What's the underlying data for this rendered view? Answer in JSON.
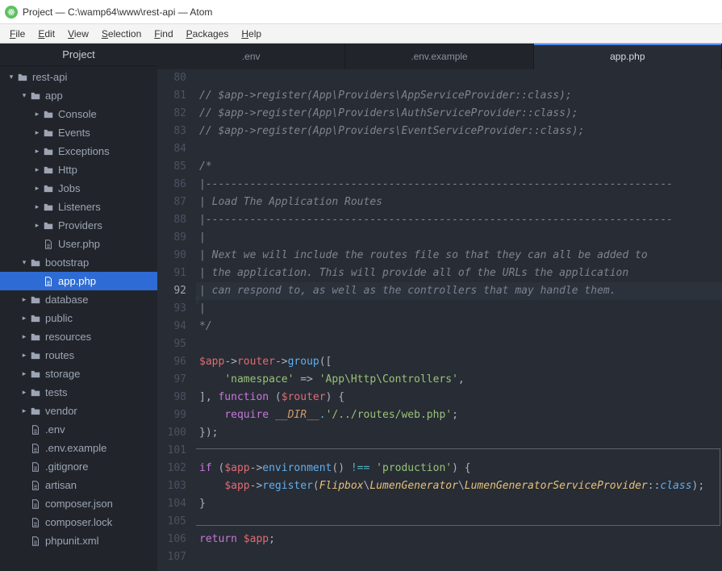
{
  "window": {
    "title": "Project — C:\\wamp64\\www\\rest-api — Atom"
  },
  "menu": {
    "items": [
      "File",
      "Edit",
      "View",
      "Selection",
      "Find",
      "Packages",
      "Help"
    ]
  },
  "sidebar": {
    "title": "Project",
    "tree": [
      {
        "depth": 0,
        "icon": "folder",
        "twist": "down",
        "label": "rest-api"
      },
      {
        "depth": 1,
        "icon": "folder",
        "twist": "down",
        "label": "app"
      },
      {
        "depth": 2,
        "icon": "folder",
        "twist": "right",
        "label": "Console"
      },
      {
        "depth": 2,
        "icon": "folder",
        "twist": "right",
        "label": "Events"
      },
      {
        "depth": 2,
        "icon": "folder",
        "twist": "right",
        "label": "Exceptions"
      },
      {
        "depth": 2,
        "icon": "folder",
        "twist": "right",
        "label": "Http"
      },
      {
        "depth": 2,
        "icon": "folder",
        "twist": "right",
        "label": "Jobs"
      },
      {
        "depth": 2,
        "icon": "folder",
        "twist": "right",
        "label": "Listeners"
      },
      {
        "depth": 2,
        "icon": "folder",
        "twist": "right",
        "label": "Providers"
      },
      {
        "depth": 2,
        "icon": "file",
        "twist": "",
        "label": "User.php"
      },
      {
        "depth": 1,
        "icon": "folder",
        "twist": "down",
        "label": "bootstrap"
      },
      {
        "depth": 2,
        "icon": "file",
        "twist": "",
        "label": "app.php",
        "selected": true
      },
      {
        "depth": 1,
        "icon": "folder",
        "twist": "right",
        "label": "database"
      },
      {
        "depth": 1,
        "icon": "folder",
        "twist": "right",
        "label": "public"
      },
      {
        "depth": 1,
        "icon": "folder",
        "twist": "right",
        "label": "resources"
      },
      {
        "depth": 1,
        "icon": "folder",
        "twist": "right",
        "label": "routes"
      },
      {
        "depth": 1,
        "icon": "folder",
        "twist": "right",
        "label": "storage"
      },
      {
        "depth": 1,
        "icon": "folder",
        "twist": "right",
        "label": "tests"
      },
      {
        "depth": 1,
        "icon": "folder",
        "twist": "right",
        "label": "vendor"
      },
      {
        "depth": 1,
        "icon": "file",
        "twist": "",
        "label": ".env"
      },
      {
        "depth": 1,
        "icon": "file",
        "twist": "",
        "label": ".env.example"
      },
      {
        "depth": 1,
        "icon": "file",
        "twist": "",
        "label": ".gitignore"
      },
      {
        "depth": 1,
        "icon": "file",
        "twist": "",
        "label": "artisan"
      },
      {
        "depth": 1,
        "icon": "file",
        "twist": "",
        "label": "composer.json"
      },
      {
        "depth": 1,
        "icon": "file",
        "twist": "",
        "label": "composer.lock"
      },
      {
        "depth": 1,
        "icon": "file",
        "twist": "",
        "label": "phpunit.xml"
      }
    ]
  },
  "tabs": [
    {
      "label": ".env",
      "active": false
    },
    {
      "label": ".env.example",
      "active": false
    },
    {
      "label": "app.php",
      "active": true
    }
  ],
  "editor": {
    "first_line": 80,
    "current_line": 92,
    "lines": [
      {
        "n": 80,
        "tokens": [
          {
            "t": "",
            "c": ""
          }
        ]
      },
      {
        "n": 81,
        "tokens": [
          {
            "t": "// $app->register(App\\Providers\\AppServiceProvider::class);",
            "c": "c-comment"
          }
        ]
      },
      {
        "n": 82,
        "tokens": [
          {
            "t": "// $app->register(App\\Providers\\AuthServiceProvider::class);",
            "c": "c-comment"
          }
        ]
      },
      {
        "n": 83,
        "tokens": [
          {
            "t": "// $app->register(App\\Providers\\EventServiceProvider::class);",
            "c": "c-comment"
          }
        ]
      },
      {
        "n": 84,
        "tokens": [
          {
            "t": "",
            "c": ""
          }
        ]
      },
      {
        "n": 85,
        "tokens": [
          {
            "t": "/*",
            "c": "c-comment"
          }
        ]
      },
      {
        "n": 86,
        "tokens": [
          {
            "t": "|--------------------------------------------------------------------------",
            "c": "c-comment"
          }
        ]
      },
      {
        "n": 87,
        "tokens": [
          {
            "t": "| Load The Application Routes",
            "c": "c-comment"
          }
        ]
      },
      {
        "n": 88,
        "tokens": [
          {
            "t": "|--------------------------------------------------------------------------",
            "c": "c-comment"
          }
        ]
      },
      {
        "n": 89,
        "tokens": [
          {
            "t": "|",
            "c": "c-comment"
          }
        ]
      },
      {
        "n": 90,
        "tokens": [
          {
            "t": "| Next we will include the routes file so that they can all be added to",
            "c": "c-comment"
          }
        ]
      },
      {
        "n": 91,
        "tokens": [
          {
            "t": "| the application. This will provide all of the URLs the application",
            "c": "c-comment"
          }
        ]
      },
      {
        "n": 92,
        "tokens": [
          {
            "t": "| can respond to, as well as the controllers that may handle them.",
            "c": "c-comment"
          }
        ]
      },
      {
        "n": 93,
        "tokens": [
          {
            "t": "|",
            "c": "c-comment"
          }
        ]
      },
      {
        "n": 94,
        "tokens": [
          {
            "t": "*/",
            "c": "c-comment"
          }
        ]
      },
      {
        "n": 95,
        "tokens": [
          {
            "t": "",
            "c": ""
          }
        ]
      },
      {
        "n": 96,
        "tokens": [
          {
            "t": "$app",
            "c": "c-var"
          },
          {
            "t": "->",
            "c": "c-punc"
          },
          {
            "t": "router",
            "c": "c-var"
          },
          {
            "t": "->",
            "c": "c-punc"
          },
          {
            "t": "group",
            "c": "c-func"
          },
          {
            "t": "([",
            "c": "c-punc"
          }
        ]
      },
      {
        "n": 97,
        "tokens": [
          {
            "t": "    ",
            "c": ""
          },
          {
            "t": "'namespace'",
            "c": "c-str"
          },
          {
            "t": " => ",
            "c": "c-punc"
          },
          {
            "t": "'App\\Http\\Controllers'",
            "c": "c-str"
          },
          {
            "t": ",",
            "c": "c-punc"
          }
        ]
      },
      {
        "n": 98,
        "tokens": [
          {
            "t": "], ",
            "c": "c-punc"
          },
          {
            "t": "function",
            "c": "c-key"
          },
          {
            "t": " (",
            "c": "c-punc"
          },
          {
            "t": "$router",
            "c": "c-var"
          },
          {
            "t": ") {",
            "c": "c-punc"
          }
        ]
      },
      {
        "n": 99,
        "tokens": [
          {
            "t": "    ",
            "c": ""
          },
          {
            "t": "require",
            "c": "c-key"
          },
          {
            "t": " ",
            "c": ""
          },
          {
            "t": "__DIR__",
            "c": "c-const"
          },
          {
            "t": ".",
            "c": "c-op"
          },
          {
            "t": "'/../routes/web.php'",
            "c": "c-str"
          },
          {
            "t": ";",
            "c": "c-punc"
          }
        ]
      },
      {
        "n": 100,
        "tokens": [
          {
            "t": "});",
            "c": "c-punc"
          }
        ]
      },
      {
        "n": 101,
        "tokens": [
          {
            "t": "",
            "c": ""
          }
        ]
      },
      {
        "n": 102,
        "tokens": [
          {
            "t": "if",
            "c": "c-key"
          },
          {
            "t": " (",
            "c": "c-punc"
          },
          {
            "t": "$app",
            "c": "c-var"
          },
          {
            "t": "->",
            "c": "c-punc"
          },
          {
            "t": "environment",
            "c": "c-func"
          },
          {
            "t": "() ",
            "c": "c-punc"
          },
          {
            "t": "!==",
            "c": "c-op"
          },
          {
            "t": " ",
            "c": ""
          },
          {
            "t": "'production'",
            "c": "c-str"
          },
          {
            "t": ") {",
            "c": "c-punc"
          }
        ]
      },
      {
        "n": 103,
        "tokens": [
          {
            "t": "    ",
            "c": ""
          },
          {
            "t": "$app",
            "c": "c-var"
          },
          {
            "t": "->",
            "c": "c-punc"
          },
          {
            "t": "register",
            "c": "c-func"
          },
          {
            "t": "(",
            "c": "c-punc"
          },
          {
            "t": "Flipbox",
            "c": "c-class"
          },
          {
            "t": "\\",
            "c": "c-punc"
          },
          {
            "t": "LumenGenerator",
            "c": "c-class"
          },
          {
            "t": "\\",
            "c": "c-punc"
          },
          {
            "t": "LumenGeneratorServiceProvider",
            "c": "c-class"
          },
          {
            "t": "::",
            "c": "c-punc"
          },
          {
            "t": "class",
            "c": "c-func-i"
          },
          {
            "t": ");",
            "c": "c-punc"
          }
        ]
      },
      {
        "n": 104,
        "tokens": [
          {
            "t": "}",
            "c": "c-punc"
          }
        ]
      },
      {
        "n": 105,
        "tokens": [
          {
            "t": "",
            "c": ""
          }
        ]
      },
      {
        "n": 106,
        "tokens": [
          {
            "t": "return",
            "c": "c-key"
          },
          {
            "t": " ",
            "c": ""
          },
          {
            "t": "$app",
            "c": "c-var"
          },
          {
            "t": ";",
            "c": "c-punc"
          }
        ]
      },
      {
        "n": 107,
        "tokens": [
          {
            "t": "",
            "c": ""
          }
        ]
      }
    ],
    "highlight_box": {
      "top_line": 101,
      "height_lines": 5
    }
  }
}
